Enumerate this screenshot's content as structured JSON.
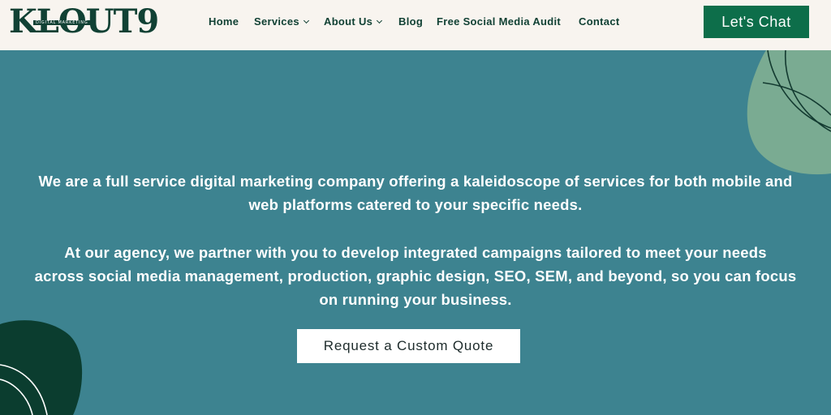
{
  "brand": {
    "logo_text": "KLOUT9",
    "logo_tagline": "DIGITAL MARKETING"
  },
  "nav": {
    "items": [
      {
        "label": "Home"
      },
      {
        "label": "Services",
        "has_dropdown": true
      },
      {
        "label": "About Us",
        "has_dropdown": true
      },
      {
        "label": "Blog"
      },
      {
        "label": "Free Social Media Audit"
      },
      {
        "label": "Contact"
      }
    ],
    "cta_label": "Let's Chat"
  },
  "hero": {
    "paragraph1_line1": "We are a full service digital marketing company offering a kaleidoscope of services for both mobile and",
    "paragraph1_line2": "web platforms catered to your specific needs.",
    "paragraph2_line1": "At our agency, we partner with you to develop integrated campaigns tailored to meet your needs",
    "paragraph2_line2": "across social media management, production, graphic design, SEO, SEM, and beyond, so you can focus",
    "paragraph2_line3": "on running your business.",
    "button_label": "Request a Custom Quote"
  },
  "colors": {
    "header_bg": "#f8f4ef",
    "hero_bg": "#3d8390",
    "brand_dark_green": "#114134",
    "cta_green": "#0d6e4a",
    "blob_sage": "#7aab92",
    "blob_dark": "#0b3d2f"
  },
  "icons": [
    "chevron-down-icon"
  ]
}
